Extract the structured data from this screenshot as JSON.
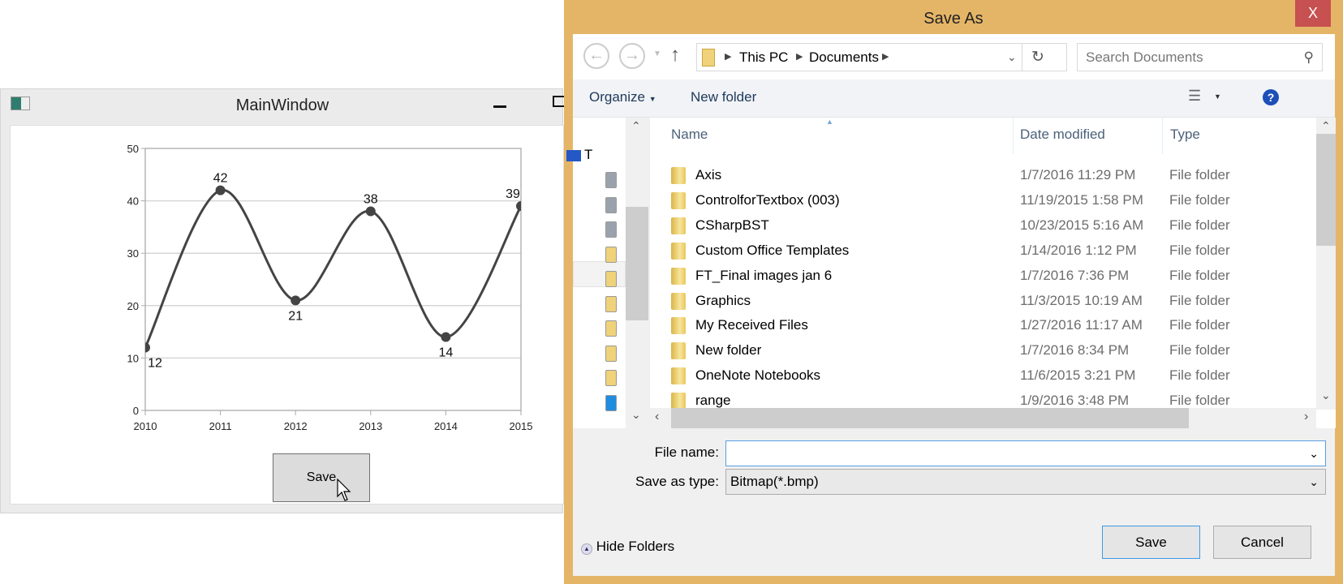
{
  "main_window": {
    "title": "MainWindow",
    "save_label": "Save",
    "chart_data": {
      "type": "line",
      "smooth": true,
      "categories": [
        "2010",
        "2011",
        "2012",
        "2013",
        "2014",
        "2015"
      ],
      "values": [
        12,
        42,
        21,
        38,
        14,
        39
      ],
      "data_labels": [
        "12",
        "42",
        "21",
        "38",
        "14",
        "39"
      ],
      "ylim": [
        0,
        50
      ],
      "yticks": [
        "0",
        "10",
        "20",
        "30",
        "40",
        "50"
      ],
      "grid": true,
      "line_color": "#444444",
      "title": "",
      "xlabel": "",
      "ylabel": ""
    }
  },
  "dialog": {
    "title": "Save As",
    "close_label": "X",
    "breadcrumb": [
      "This PC",
      "Documents"
    ],
    "search_placeholder": "Search Documents",
    "toolbar": {
      "organize": "Organize",
      "new_folder": "New folder"
    },
    "nav_pane_partial": "T",
    "columns": {
      "name": "Name",
      "date": "Date modified",
      "type": "Type"
    },
    "files": [
      {
        "name": "Axis",
        "date": "1/7/2016 11:29 PM",
        "type": "File folder"
      },
      {
        "name": "ControlforTextbox (003)",
        "date": "11/19/2015 1:58 PM",
        "type": "File folder"
      },
      {
        "name": "CSharpBST",
        "date": "10/23/2015 5:16 AM",
        "type": "File folder"
      },
      {
        "name": "Custom Office Templates",
        "date": "1/14/2016 1:12 PM",
        "type": "File folder"
      },
      {
        "name": "FT_Final images jan 6",
        "date": "1/7/2016 7:36 PM",
        "type": "File folder"
      },
      {
        "name": "Graphics",
        "date": "11/3/2015 10:19 AM",
        "type": "File folder"
      },
      {
        "name": "My Received Files",
        "date": "1/27/2016 11:17 AM",
        "type": "File folder"
      },
      {
        "name": "New folder",
        "date": "1/7/2016 8:34 PM",
        "type": "File folder"
      },
      {
        "name": "OneNote Notebooks",
        "date": "11/6/2015 3:21 PM",
        "type": "File folder"
      },
      {
        "name": "range",
        "date": "1/9/2016 3:48 PM",
        "type": "File folder"
      }
    ],
    "file_name_label": "File name:",
    "file_name_value": "",
    "save_type_label": "Save as type:",
    "save_type_value": "Bitmap(*.bmp)",
    "hide_folders": "Hide Folders",
    "save_button": "Save",
    "cancel_button": "Cancel",
    "accent_color": "#e5b567"
  }
}
